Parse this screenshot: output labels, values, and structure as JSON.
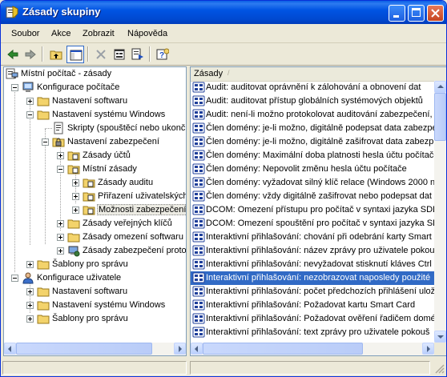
{
  "window": {
    "title": "Zásady skupiny"
  },
  "menu": [
    "Soubor",
    "Akce",
    "Zobrazit",
    "Nápověda"
  ],
  "toolbar": {
    "icons": [
      "back-icon",
      "forward-icon",
      "up-folder-icon",
      "show-hide-tree-icon",
      "delete-icon",
      "properties-icon",
      "export-list-icon",
      "help-icon"
    ]
  },
  "tree": [
    {
      "label": "Místní počítač - zásady",
      "icon": "policy-computer-icon"
    },
    {
      "label": "Konfigurace počítače",
      "icon": "computer-icon"
    },
    {
      "label": "Nastavení softwaru",
      "icon": "folder-icon"
    },
    {
      "label": "Nastavení systému Windows",
      "icon": "folder-icon"
    },
    {
      "label": "Skripty (spouštěcí nebo ukonč",
      "icon": "scripts-icon"
    },
    {
      "label": "Nastavení zabezpečení",
      "icon": "security-icon"
    },
    {
      "label": "Zásady účtů",
      "icon": "policy-folder-icon"
    },
    {
      "label": "Místní zásady",
      "icon": "policy-folder-icon"
    },
    {
      "label": "Zásady auditu",
      "icon": "policy-folder-icon"
    },
    {
      "label": "Přiřazení uživatelských",
      "icon": "policy-folder-icon"
    },
    {
      "label": "Možnosti zabezpečení",
      "icon": "policy-folder-icon"
    },
    {
      "label": "Zásady veřejných klíčů",
      "icon": "folder-icon"
    },
    {
      "label": "Zásady omezení softwaru",
      "icon": "folder-icon"
    },
    {
      "label": "Zásady zabezpečení proto",
      "icon": "ipsec-icon"
    },
    {
      "label": "Šablony pro správu",
      "icon": "folder-icon"
    },
    {
      "label": "Konfigurace uživatele",
      "icon": "user-icon"
    },
    {
      "label": "Nastavení softwaru",
      "icon": "folder-icon"
    },
    {
      "label": "Nastavení systému Windows",
      "icon": "folder-icon"
    },
    {
      "label": "Šablony pro správu",
      "icon": "folder-icon"
    }
  ],
  "list": {
    "column_header": "Zásady",
    "items": [
      "Audit: auditovat oprávnění k zálohování a obnovení dat",
      "Audit: auditovat přístup globálních systémových objektů",
      "Audit: není-li možno protokolovat auditování zabezpečení,",
      "Člen domény: je-li možno, digitálně podepsat data zabezpeč",
      "Člen domény: je-li možno, digitálně zašifrovat data zabezp",
      "Člen domény: Maximální doba platnosti hesla účtu počítače",
      "Člen domény: Nepovolit změnu hesla účtu počítače",
      "Člen domény: vyžadovat silný klíč relace (Windows 2000 n",
      "Člen domény: vždy digitálně zašifrovat nebo podepsat dat",
      "DCOM: Omezení přístupu pro počítač v syntaxi jazyka SDD",
      "DCOM: Omezení spouštění pro počítač v syntaxi jazyka SDD",
      "Interaktivní přihlašování: chování při odebrání karty Smart",
      "Interaktivní přihlašování: název zprávy pro uživatele pokou",
      "Interaktivní přihlašování: nevyžadovat stisknutí kláves Ctrl",
      "Interaktivní přihlašování: nezobrazovat naposledy použité",
      "Interaktivní přihlašování: počet předchozích přihlášení ulož",
      "Interaktivní přihlašování: Požadovat kartu Smart Card",
      "Interaktivní přihlašování: Požadovat ověření řadičem domé",
      "Interaktivní přihlašování: text zprávy pro uživatele pokouš"
    ],
    "selected_index": 14,
    "item_icon": "policy-setting-icon"
  }
}
